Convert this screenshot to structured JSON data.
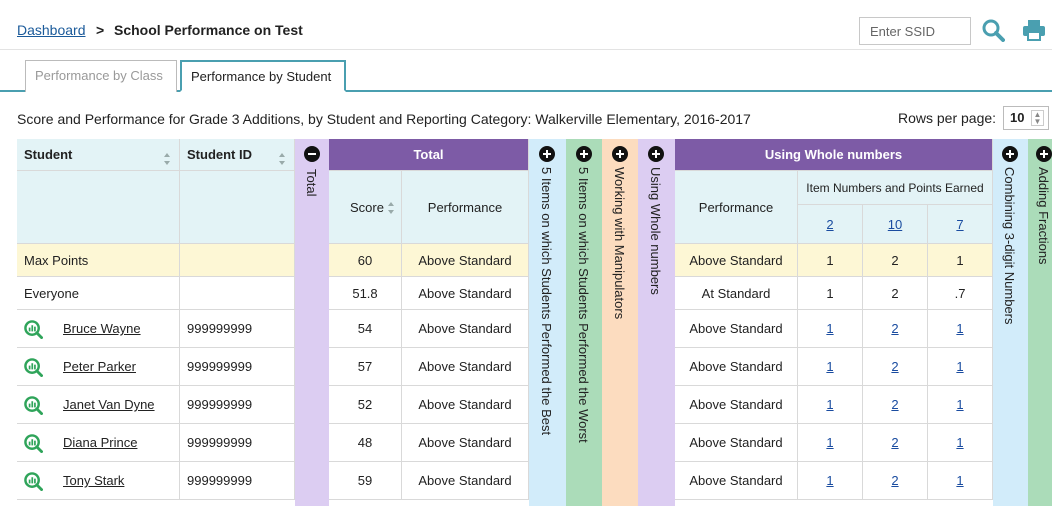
{
  "breadcrumb": {
    "dashboard_label": "Dashboard",
    "separator": ">",
    "title": "School Performance on Test"
  },
  "search": {
    "placeholder": "Enter SSID",
    "icon": "search-icon"
  },
  "print": {
    "icon": "printer-icon"
  },
  "tabs": [
    {
      "label": "Performance by Class",
      "active": false
    },
    {
      "label": "Performance by Student",
      "active": true
    }
  ],
  "caption": "Score and Performance for Grade 3 Additions, by Student and Reporting Category: Walkerville Elementary, 2016-2017",
  "rows_per_page": {
    "label": "Rows per page:",
    "value": "10"
  },
  "colors": {
    "teal": "#4a9fb0",
    "purple": "#7d5ba6",
    "lavender": "#dccdf2",
    "light_blue": "#d2ecfa",
    "green": "#abdcb9",
    "peach": "#fcdcbf",
    "max_row": "#fdf7d5"
  },
  "table": {
    "headers": {
      "student": "Student",
      "student_id": "Student ID",
      "total_vertical": "Total",
      "total_group": "Total",
      "score": "Score",
      "performance": "Performance",
      "best5": "5 Items on which Students Performed the Best",
      "worst5": "5 Items on which Students Performed the Worst",
      "manipulators": "Working with Manipulators",
      "whole_vertical": "Using Whole numbers",
      "whole_group": "Using Whole numbers",
      "whole_performance": "Performance",
      "item_numbers": "Item Numbers and Points Earned",
      "item_links": [
        "2",
        "10",
        "7"
      ],
      "combining": "Combining 3-digit Numbers",
      "adding": "Adding Fractions"
    },
    "max_row": {
      "label": "Max Points",
      "score": "60",
      "performance": "Above Standard",
      "whole_performance": "Above Standard",
      "points": [
        "1",
        "2",
        "1"
      ]
    },
    "everyone_row": {
      "label": "Everyone",
      "score": "51.8",
      "performance": "Above Standard",
      "whole_performance": "At Standard",
      "points": [
        "1",
        "2",
        ".7"
      ]
    },
    "students": [
      {
        "name": "Bruce Wayne",
        "id": "999999999",
        "score": "54",
        "performance": "Above Standard",
        "whole_performance": "Above Standard",
        "points": [
          "1",
          "2",
          "1"
        ]
      },
      {
        "name": "Peter Parker",
        "id": "999999999",
        "score": "57",
        "performance": "Above Standard",
        "whole_performance": "Above Standard",
        "points": [
          "1",
          "2",
          "1"
        ]
      },
      {
        "name": "Janet Van Dyne",
        "id": "999999999",
        "score": "52",
        "performance": "Above Standard",
        "whole_performance": "Above Standard",
        "points": [
          "1",
          "2",
          "1"
        ]
      },
      {
        "name": "Diana Prince",
        "id": "999999999",
        "score": "48",
        "performance": "Above Standard",
        "whole_performance": "Above Standard",
        "points": [
          "1",
          "2",
          "1"
        ]
      },
      {
        "name": "Tony Stark",
        "id": "999999999",
        "score": "59",
        "performance": "Above Standard",
        "whole_performance": "Above Standard",
        "points": [
          "1",
          "2",
          "1"
        ]
      }
    ]
  }
}
